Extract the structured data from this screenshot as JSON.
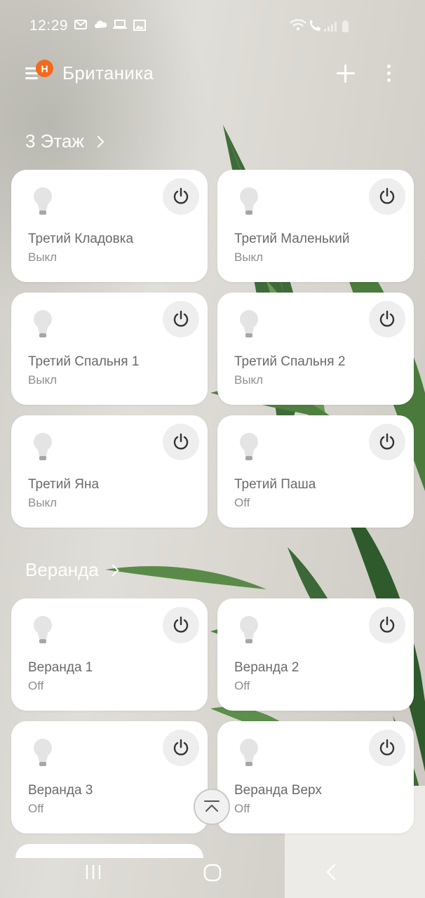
{
  "status_bar": {
    "time": "12:29"
  },
  "header": {
    "avatar_letter": "H",
    "title": "Британика"
  },
  "sections": [
    {
      "title": "3 Этаж",
      "devices": [
        {
          "name": "Третий Кладовка",
          "state": "Выкл"
        },
        {
          "name": "Третий Маленький",
          "state": "Выкл"
        },
        {
          "name": "Третий Спальня 1",
          "state": "Выкл"
        },
        {
          "name": "Третий Спальня 2",
          "state": "Выкл"
        },
        {
          "name": "Третий Яна",
          "state": "Выкл"
        },
        {
          "name": "Третий Паша",
          "state": "Off"
        }
      ]
    },
    {
      "title": "Веранда",
      "devices": [
        {
          "name": "Веранда 1",
          "state": "Off"
        },
        {
          "name": "Веранда 2",
          "state": "Off"
        },
        {
          "name": "Веранда 3",
          "state": "Off"
        },
        {
          "name": "Веранда Верх",
          "state": "Off"
        }
      ]
    }
  ],
  "colors": {
    "badge": "#f26a1b",
    "card": "#ffffff",
    "text_primary": "#6a6a6a",
    "text_secondary": "#8e8e8e"
  },
  "icons": {
    "device": "light-bulb-icon",
    "power": "power-icon",
    "scroll_top": "chevron-up-icon"
  }
}
